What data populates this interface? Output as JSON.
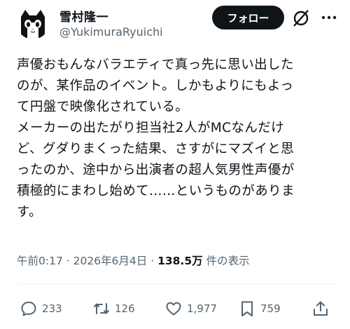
{
  "user": {
    "name": "雪村隆一",
    "handle": "@YukimuraRyuichi",
    "follow_label": "フォロー"
  },
  "tweet": {
    "lines": [
      "声優おもんなバラエティで真っ先に思い出した",
      "のが、某作品のイベント。しかもよりにもよっ",
      "て円盤で映像化されている。",
      "メーカーの出たがり担当社2人がMCなんだけ",
      "ど、グダりまくった結果、さすがにマズイと思",
      "ったのか、途中から出演者の超人気男性声優が",
      "積極的にまわし始めて……というものがありま",
      "す。"
    ]
  },
  "meta": {
    "time": "午前0:17",
    "date": "2026年6月4日",
    "views_count": "138.5万",
    "views_label": "件の表示"
  },
  "actions": {
    "replies": "233",
    "reposts": "126",
    "likes": "1,977",
    "bookmarks": "759"
  },
  "icons": {
    "avatar": "cat-avatar-icon",
    "grok": "grok-icon",
    "more": "more-icon",
    "reply": "reply-icon",
    "repost": "repost-icon",
    "like": "heart-icon",
    "bookmark": "bookmark-icon",
    "share": "share-icon"
  },
  "colors": {
    "text": "#0f1419",
    "secondary": "#536471",
    "button_bg": "#0f1419",
    "button_text": "#ffffff"
  }
}
